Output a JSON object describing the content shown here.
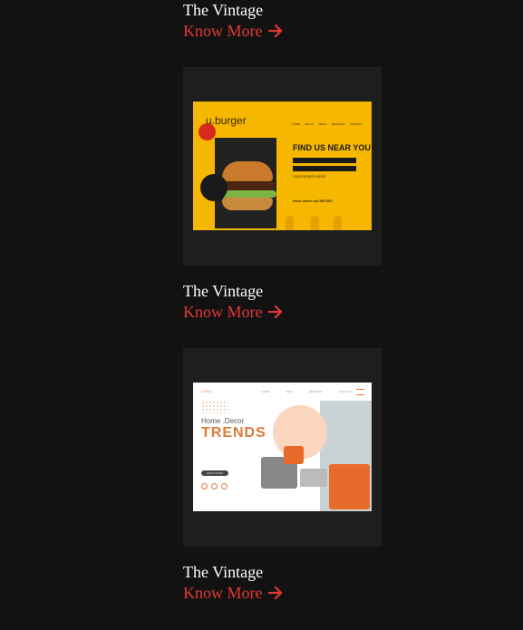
{
  "items": [
    {
      "title": "The Vintage",
      "link": "Know More"
    },
    {
      "title": "The Vintage",
      "link": "Know More"
    },
    {
      "title": "The Vintage",
      "link": "Know More"
    }
  ],
  "thumbnails": {
    "burger": {
      "logo": "u.burger",
      "nav": [
        "HOME",
        "ABOUT",
        "MENU",
        "SERVICES",
        "CONTACT"
      ],
      "heading": "FIND US NEAR YOU",
      "search_label": "YOUR SEARCH HERE",
      "footer": "Home orders call 555 0567"
    },
    "decor": {
      "logo": "LOGO",
      "nav": [
        "HOME",
        "INFO",
        "SERVICES",
        "CONTACT"
      ],
      "heading": "Home .Decor",
      "headline": "TRENDS",
      "button": "READ MORE"
    }
  },
  "colors": {
    "background": "#121212",
    "card": "#1e1e1e",
    "accent": "#e53935",
    "title": "#ffffff"
  },
  "icons": {
    "link_arrow": "arrow-right-icon"
  }
}
